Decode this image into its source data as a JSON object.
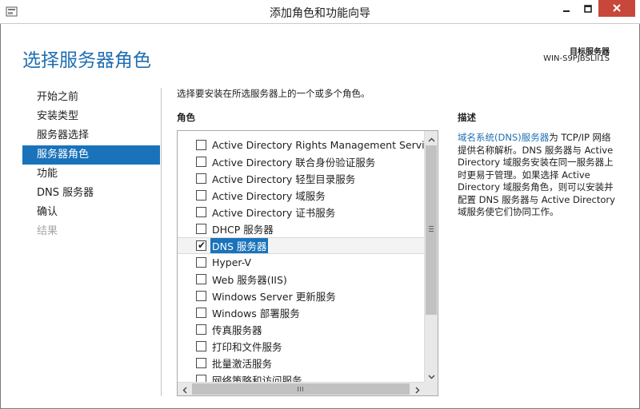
{
  "window": {
    "title": "添加角色和功能向导",
    "colors": {
      "accent": "#1a73ba",
      "title_text": "#1f6fb2",
      "close": "#c7483a"
    }
  },
  "header": {
    "page_title": "选择服务器角色",
    "target_label": "目标服务器",
    "target_value": "WIN-S9PJBSLII1S"
  },
  "nav": {
    "items": [
      {
        "label": "开始之前",
        "state": "normal"
      },
      {
        "label": "安装类型",
        "state": "normal"
      },
      {
        "label": "服务器选择",
        "state": "normal"
      },
      {
        "label": "服务器角色",
        "state": "active"
      },
      {
        "label": "功能",
        "state": "normal"
      },
      {
        "label": "DNS 服务器",
        "state": "normal"
      },
      {
        "label": "确认",
        "state": "normal"
      },
      {
        "label": "结果",
        "state": "disabled"
      }
    ]
  },
  "main": {
    "instruction": "选择要安装在所选服务器上的一个或多个角色。",
    "roles_heading": "角色",
    "roles": [
      {
        "label": "Active Directory Rights Management Services",
        "checked": false
      },
      {
        "label": "Active Directory 联合身份验证服务",
        "checked": false
      },
      {
        "label": "Active Directory 轻型目录服务",
        "checked": false
      },
      {
        "label": "Active Directory 域服务",
        "checked": false
      },
      {
        "label": "Active Directory 证书服务",
        "checked": false
      },
      {
        "label": "DHCP 服务器",
        "checked": false
      },
      {
        "label": "DNS 服务器",
        "checked": true,
        "selected": true
      },
      {
        "label": "Hyper-V",
        "checked": false
      },
      {
        "label": "Web 服务器(IIS)",
        "checked": false
      },
      {
        "label": "Windows Server 更新服务",
        "checked": false
      },
      {
        "label": "Windows 部署服务",
        "checked": false
      },
      {
        "label": "传真服务器",
        "checked": false
      },
      {
        "label": "打印和文件服务",
        "checked": false
      },
      {
        "label": "批量激活服务",
        "checked": false
      },
      {
        "label": "网络策略和访问服务",
        "checked": false
      }
    ],
    "description": {
      "heading": "描述",
      "link_text": "域名系统(DNS)服务器",
      "text": "为 TCP/IP 网络提供名称解析。DNS 服务器与 Active Directory 域服务安装在同一服务器上时更易于管理。如果选择 Active Directory 域服务角色，则可以安装并配置 DNS 服务器与 Active Directory 域服务使它们协同工作。"
    }
  }
}
